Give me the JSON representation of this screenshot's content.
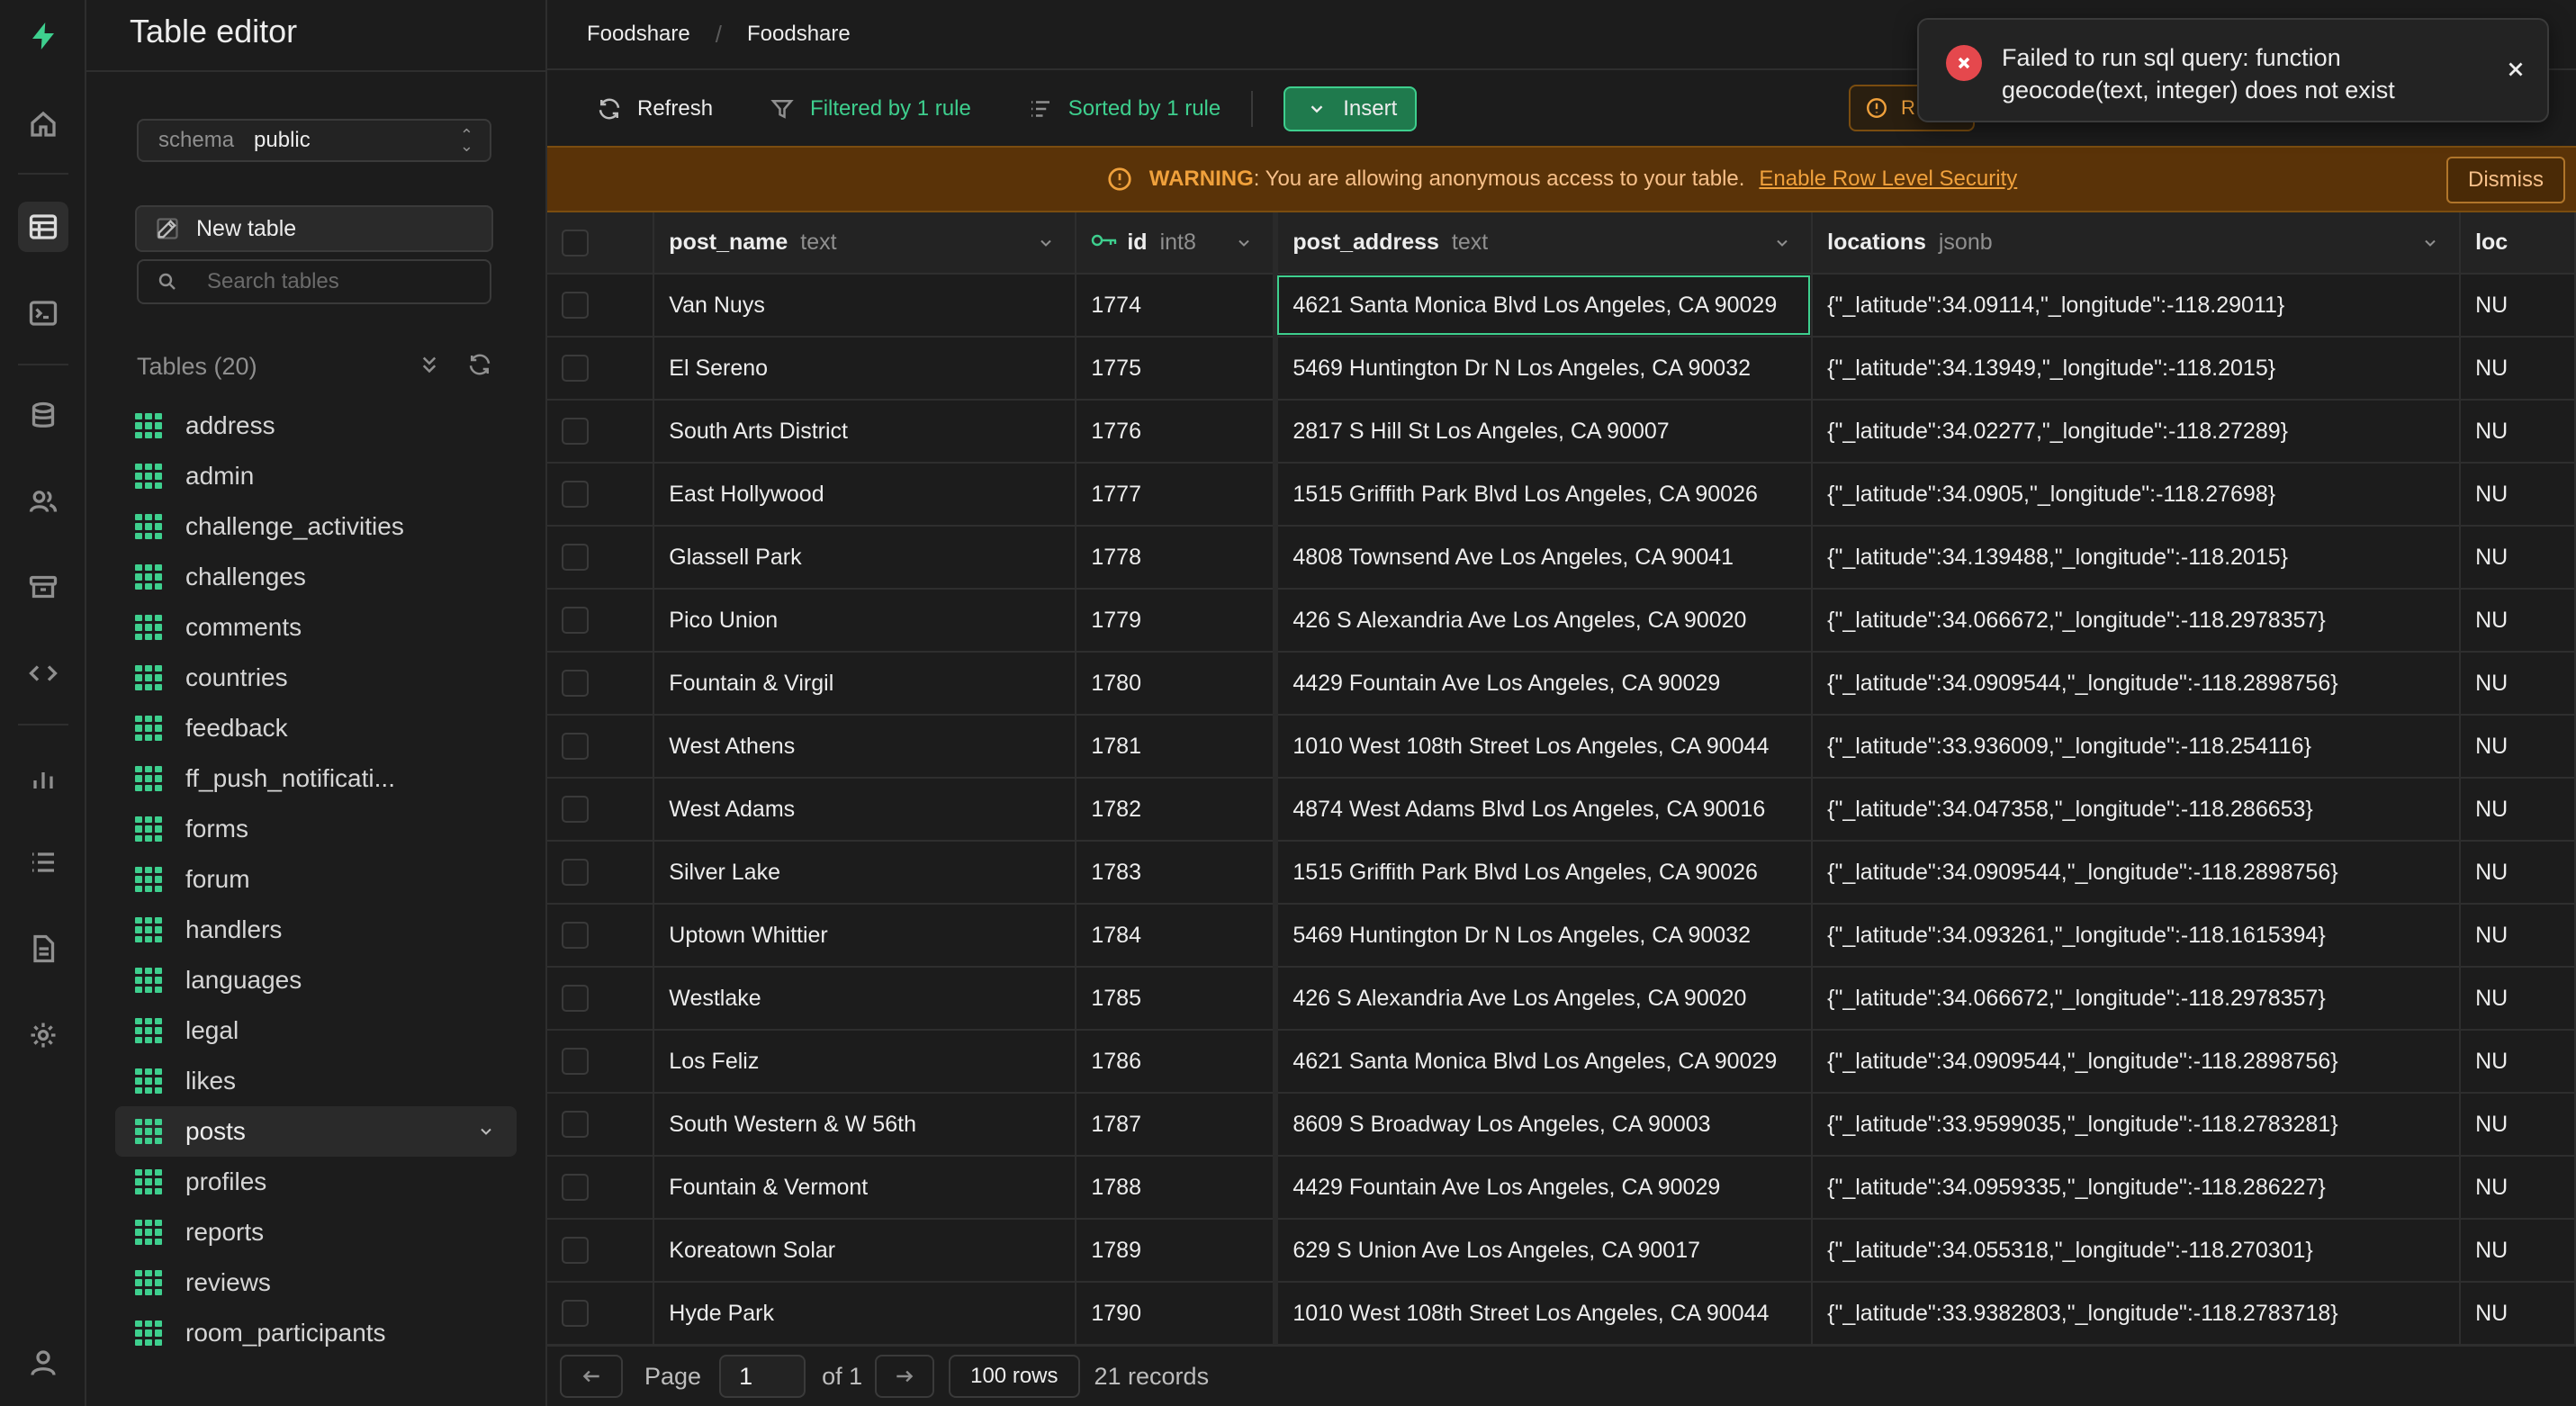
{
  "breadcrumb": [
    "Foodshare",
    "Foodshare"
  ],
  "sidebar": {
    "title": "Table editor",
    "schema_label": "schema",
    "schema_value": "public",
    "new_table_label": "New table",
    "search_placeholder": "Search tables",
    "tables_header": "Tables (20)",
    "tables": [
      "address",
      "admin",
      "challenge_activities",
      "challenges",
      "comments",
      "countries",
      "feedback",
      "ff_push_notificati...",
      "forms",
      "forum",
      "handlers",
      "languages",
      "legal",
      "likes",
      "posts",
      "profiles",
      "reports",
      "reviews",
      "room_participants"
    ],
    "selected_table": "posts"
  },
  "toolbar": {
    "refresh_label": "Refresh",
    "filter_label": "Filtered by 1 rule",
    "sort_label": "Sorted by 1 rule",
    "insert_label": "Insert",
    "rls_chip_label": "R"
  },
  "warning": {
    "strong": "WARNING",
    "text": ": You are allowing anonymous access to your table.",
    "link": "Enable Row Level Security",
    "dismiss_label": "Dismiss"
  },
  "toast": {
    "message": "Failed to run sql query: function geocode(text, integer) does not exist"
  },
  "columns": [
    {
      "name": "post_name",
      "type": "text"
    },
    {
      "name": "id",
      "type": "int8"
    },
    {
      "name": "post_address",
      "type": "text"
    },
    {
      "name": "locations",
      "type": "jsonb"
    },
    {
      "name": "loc",
      "type": ""
    }
  ],
  "rows": [
    {
      "post_name": "Van Nuys",
      "id": "1774",
      "post_address": "4621 Santa Monica Blvd Los Angeles, CA 90029",
      "locations": "{\"_latitude\":34.09114,\"_longitude\":-118.29011}",
      "loc": "NU"
    },
    {
      "post_name": "El Sereno",
      "id": "1775",
      "post_address": "5469 Huntington Dr N Los Angeles, CA 90032",
      "locations": "{\"_latitude\":34.13949,\"_longitude\":-118.2015}",
      "loc": "NU"
    },
    {
      "post_name": "South Arts District",
      "id": "1776",
      "post_address": "2817 S Hill St Los Angeles, CA 90007",
      "locations": "{\"_latitude\":34.02277,\"_longitude\":-118.27289}",
      "loc": "NU"
    },
    {
      "post_name": "East Hollywood",
      "id": "1777",
      "post_address": "1515 Griffith Park Blvd Los Angeles, CA 90026",
      "locations": "{\"_latitude\":34.0905,\"_longitude\":-118.27698}",
      "loc": "NU"
    },
    {
      "post_name": "Glassell Park",
      "id": "1778",
      "post_address": "4808 Townsend Ave Los Angeles, CA 90041",
      "locations": "{\"_latitude\":34.139488,\"_longitude\":-118.2015}",
      "loc": "NU"
    },
    {
      "post_name": "Pico Union",
      "id": "1779",
      "post_address": "426 S Alexandria Ave Los Angeles, CA 90020",
      "locations": "{\"_latitude\":34.066672,\"_longitude\":-118.2978357}",
      "loc": "NU"
    },
    {
      "post_name": "Fountain & Virgil",
      "id": "1780",
      "post_address": "4429 Fountain Ave Los Angeles, CA 90029",
      "locations": "{\"_latitude\":34.0909544,\"_longitude\":-118.2898756}",
      "loc": "NU"
    },
    {
      "post_name": "West Athens",
      "id": "1781",
      "post_address": "1010 West 108th Street Los Angeles, CA 90044",
      "locations": "{\"_latitude\":33.936009,\"_longitude\":-118.254116}",
      "loc": "NU"
    },
    {
      "post_name": "West Adams",
      "id": "1782",
      "post_address": "4874 West Adams Blvd Los Angeles, CA 90016",
      "locations": "{\"_latitude\":34.047358,\"_longitude\":-118.286653}",
      "loc": "NU"
    },
    {
      "post_name": "Silver Lake",
      "id": "1783",
      "post_address": "1515 Griffith Park Blvd Los Angeles, CA 90026",
      "locations": "{\"_latitude\":34.0909544,\"_longitude\":-118.2898756}",
      "loc": "NU"
    },
    {
      "post_name": "Uptown Whittier",
      "id": "1784",
      "post_address": "5469 Huntington Dr N Los Angeles, CA 90032",
      "locations": "{\"_latitude\":34.093261,\"_longitude\":-118.1615394}",
      "loc": "NU"
    },
    {
      "post_name": "Westlake",
      "id": "1785",
      "post_address": "426 S Alexandria Ave Los Angeles, CA 90020",
      "locations": "{\"_latitude\":34.066672,\"_longitude\":-118.2978357}",
      "loc": "NU"
    },
    {
      "post_name": "Los Feliz",
      "id": "1786",
      "post_address": "4621 Santa Monica Blvd Los Angeles, CA 90029",
      "locations": "{\"_latitude\":34.0909544,\"_longitude\":-118.2898756}",
      "loc": "NU"
    },
    {
      "post_name": "South Western & W 56th",
      "id": "1787",
      "post_address": "8609 S Broadway Los Angeles, CA 90003",
      "locations": "{\"_latitude\":33.9599035,\"_longitude\":-118.2783281}",
      "loc": "NU"
    },
    {
      "post_name": "Fountain & Vermont",
      "id": "1788",
      "post_address": "4429 Fountain Ave Los Angeles, CA 90029",
      "locations": "{\"_latitude\":34.0959335,\"_longitude\":-118.286227}",
      "loc": "NU"
    },
    {
      "post_name": "Koreatown Solar",
      "id": "1789",
      "post_address": "629 S Union Ave Los Angeles, CA 90017",
      "locations": "{\"_latitude\":34.055318,\"_longitude\":-118.270301}",
      "loc": "NU"
    },
    {
      "post_name": "Hyde Park",
      "id": "1790",
      "post_address": "1010 West 108th Street Los Angeles, CA 90044",
      "locations": "{\"_latitude\":33.9382803,\"_longitude\":-118.2783718}",
      "loc": "NU"
    }
  ],
  "footer": {
    "page_label": "Page",
    "page_value": "1",
    "of_label": "of 1",
    "rows_label": "100 rows",
    "records_label": "21 records"
  },
  "colors": {
    "accent": "#3ecf8e",
    "warning_bg": "#5a3308",
    "warning_fg": "#f0a13c",
    "error": "#e5484d"
  }
}
